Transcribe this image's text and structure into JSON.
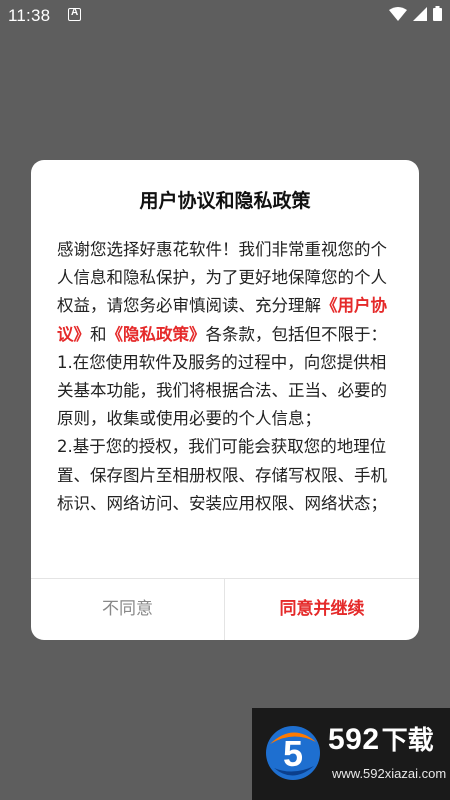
{
  "status_bar": {
    "time": "11:38",
    "app_icon": "a-notification-icon",
    "icons": [
      "wifi-icon",
      "signal-icon",
      "battery-icon"
    ]
  },
  "dialog": {
    "title": "用户协议和隐私政策",
    "para1_part1": "感谢您选择好惠花软件！我们非常重视您的个人信息和隐私保护，为了更好地保障您的个人权益，请您务必审慎阅读、充分理解",
    "link_user_agreement": "《用户协议》",
    "para1_and": "和",
    "link_privacy_policy": "《隐私政策》",
    "para1_part2": "各条款，包括但不限于：",
    "item1": " 1.在您使用软件及服务的过程中，向您提供相关基本功能，我们将根据合法、正当、必要的原则，收集或使用必要的个人信息；",
    "item2": " 2.基于您的授权，我们可能会获取您的地理位置、保存图片至相册权限、存储写权限、手机标识、网络访问、安装应用权限、网络状态；",
    "button_disagree": "不同意",
    "button_agree": "同意并继续"
  },
  "watermark": {
    "brand_number": "592",
    "brand_text": "下载",
    "url": "www.592xiazai.com"
  },
  "colors": {
    "overlay": "#5e5e5e",
    "accent_red": "#e52a2a",
    "disagree_gray": "#888888"
  }
}
